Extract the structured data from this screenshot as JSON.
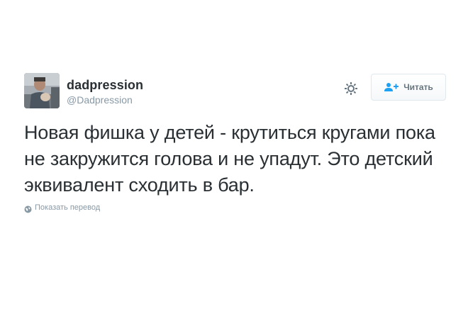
{
  "user": {
    "display_name": "dadpression",
    "handle": "@Dadpression",
    "avatar_icon": "user-avatar-photo"
  },
  "actions": {
    "settings_icon": "gear-icon",
    "follow_label": "Читать",
    "follow_icon": "add-user-icon"
  },
  "tweet": {
    "text": "Новая фишка у детей - крутиться кругами пока не закружится голова и не упадут. Это детский эквивалент сходить в бар."
  },
  "translate": {
    "label": "Показать перевод",
    "icon": "globe-icon"
  },
  "colors": {
    "text_primary": "#292f33",
    "text_secondary": "#8899a6",
    "button_text": "#66757f",
    "button_border": "#e1e8ed",
    "accent": "#1da1f2"
  }
}
